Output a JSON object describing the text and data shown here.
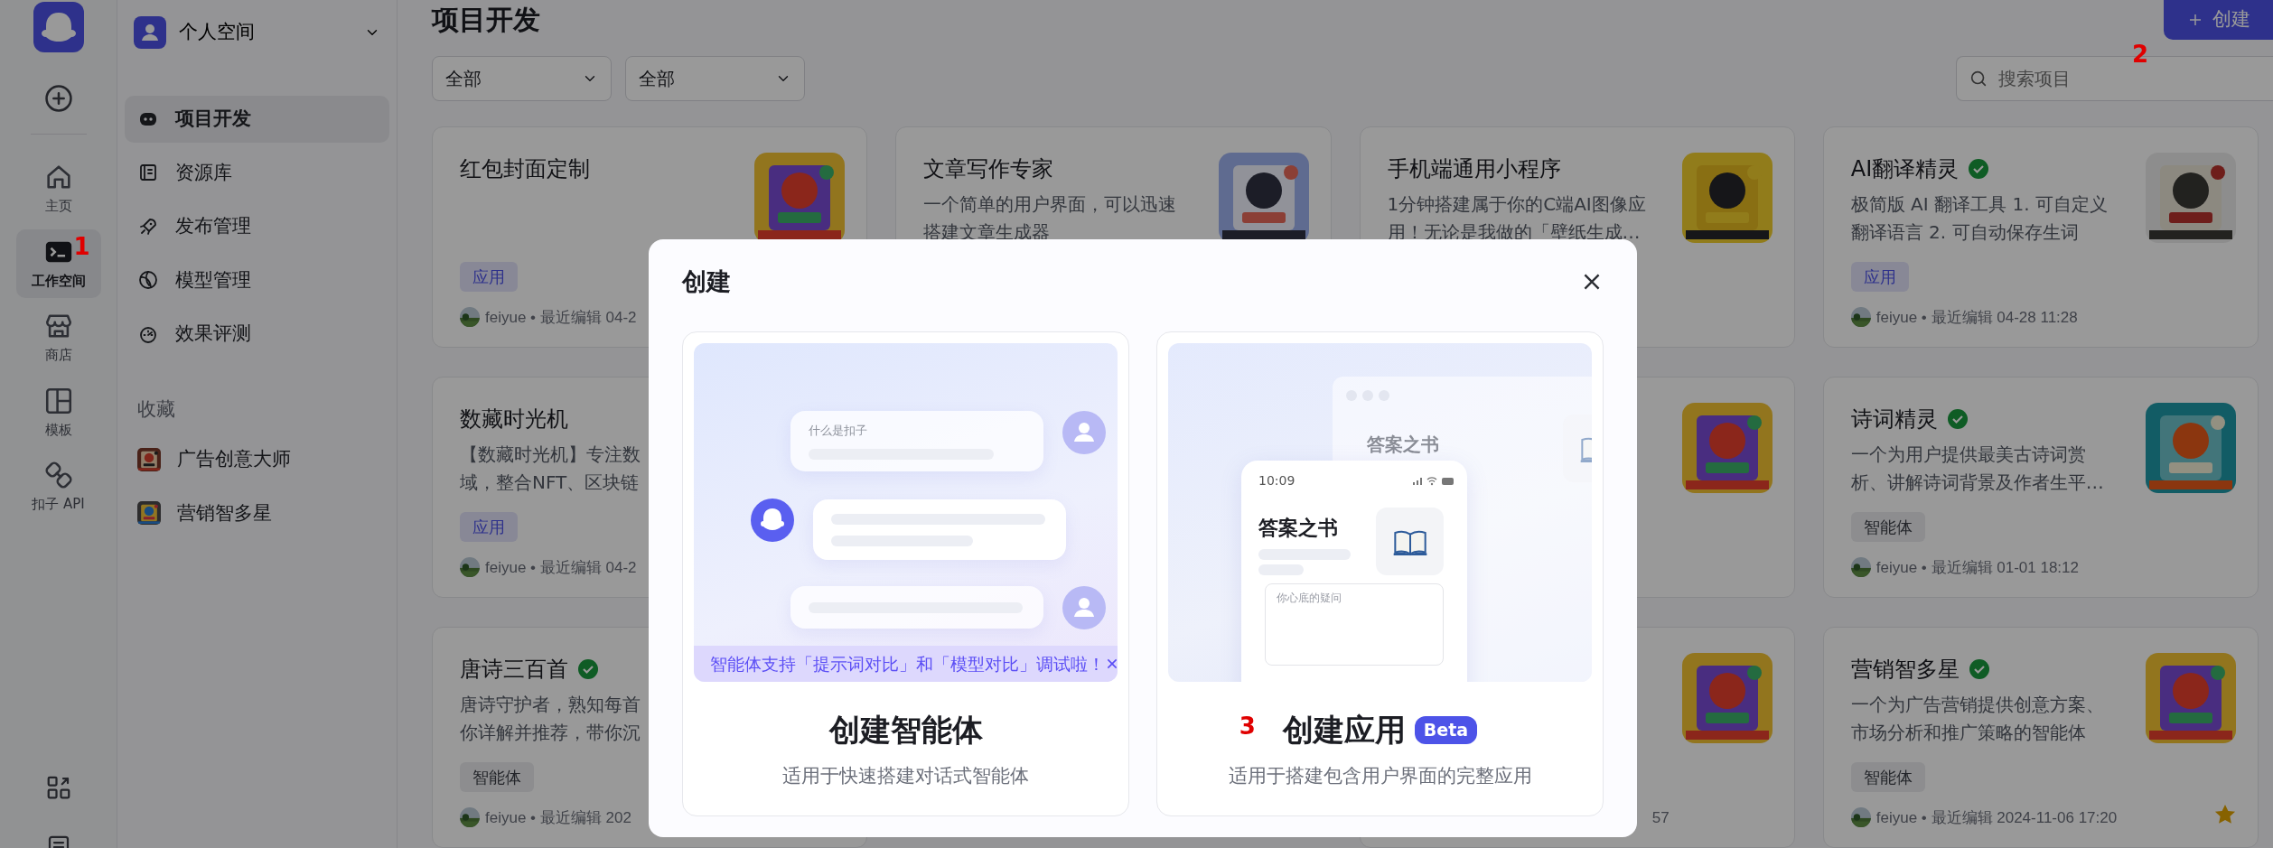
{
  "rail": {
    "items": [
      {
        "kind": "home",
        "label": "主页",
        "selected": false
      },
      {
        "kind": "terminal",
        "label": "工作空间",
        "selected": true,
        "annotation": "1"
      },
      {
        "kind": "store",
        "label": "商店",
        "selected": false
      },
      {
        "kind": "template",
        "label": "模板",
        "selected": false
      },
      {
        "kind": "plug",
        "label": "扣子 API",
        "selected": false
      }
    ]
  },
  "workspace": {
    "name": "个人空间"
  },
  "nav": {
    "items": [
      {
        "kind": "bot",
        "label": "项目开发",
        "selected": true
      },
      {
        "kind": "library",
        "label": "资源库",
        "selected": false
      },
      {
        "kind": "rocket",
        "label": "发布管理",
        "selected": false
      },
      {
        "kind": "model",
        "label": "模型管理",
        "selected": false
      },
      {
        "kind": "gauge",
        "label": "效果评测",
        "selected": false
      }
    ],
    "favorites_title": "收藏",
    "favorites": [
      {
        "label": "广告创意大师"
      },
      {
        "label": "营销智多星"
      }
    ]
  },
  "header": {
    "title": "项目开发",
    "create_button": "创建",
    "annotation": "2"
  },
  "filters": [
    {
      "value": "全部"
    },
    {
      "value": "全部"
    }
  ],
  "search": {
    "placeholder": "搜索项目"
  },
  "projects": [
    {
      "kind": "project",
      "title": "红包封面定制",
      "verified": false,
      "tag": {
        "label": "应用",
        "kind": "app"
      },
      "meta": {
        "avatar": true,
        "text": "feiyue • 最近编辑 04-2"
      }
    },
    {
      "kind": "project",
      "title": "文章写作专家",
      "verified": false,
      "description": [
        "一个简单的用户界面，可以迅速",
        "搭建文章生成器"
      ]
    },
    {
      "kind": "project",
      "title": "手机端通用小程序",
      "verified": false,
      "description": [
        "1分钟搭建属于你的C端AI图像应",
        "用！无论是我做的「壁纸生成…"
      ]
    },
    {
      "kind": "project",
      "title": "AI翻译精灵",
      "verified": true,
      "description": [
        "极简版 AI 翻译工具 1. 可自定义",
        "翻译语言 2. 可自动保存生词"
      ],
      "tag": {
        "label": "应用",
        "kind": "app"
      },
      "meta": {
        "avatar": true,
        "text": "feiyue • 最近编辑 04-28 11:28"
      },
      "starred": false
    },
    {
      "kind": "project",
      "title": "数藏时光机",
      "verified": false,
      "description": [
        "【数藏时光机】专注数",
        "域，整合NFT、区块链"
      ],
      "tag": {
        "label": "应用",
        "kind": "app"
      },
      "meta": {
        "avatar": true,
        "text": "feiyue • 最近编辑 04-2"
      }
    },
    {
      "kind": "project"
    },
    {
      "kind": "project",
      "title": "诗词精灵",
      "verified": true,
      "description": [
        "一个为用户提供最美古诗词赏",
        "析、讲解诗词背景及作者生平…"
      ],
      "tag": {
        "label": "智能体",
        "kind": "agent"
      },
      "meta": {
        "avatar": true,
        "text": "feiyue • 最近编辑 01-01 18:12"
      },
      "starred": false
    },
    {
      "kind": "project",
      "title": "唐诗三百首",
      "verified": true,
      "description": [
        "唐诗守护者，熟知每首",
        "你详解并推荐，带你沉"
      ],
      "tag": {
        "label": "智能体",
        "kind": "agent"
      },
      "meta": {
        "avatar": true,
        "text": "feiyue • 最近编辑 202"
      }
    },
    {
      "kind": "project",
      "meta": {
        "avatar": false,
        "text": "57"
      }
    },
    {
      "kind": "project",
      "title": "营销智多星",
      "verified": true,
      "description": [
        "一个为广告营销提供创意方案、",
        "市场分析和推广策略的智能体"
      ],
      "tag": {
        "label": "智能体",
        "kind": "agent"
      },
      "meta": {
        "avatar": true,
        "text": "feiyue • 最近编辑 2024-11-06 17:20"
      },
      "starred": true
    }
  ],
  "modal": {
    "title": "创建",
    "options": [
      {
        "kind": "agent",
        "illustration": {
          "question": "什么是扣子"
        },
        "banner": "智能体支持「提示词对比」和「模型对比」调试啦！",
        "heading": "创建智能体",
        "description": "适用于快速搭建对话式智能体"
      },
      {
        "kind": "app",
        "illustration": {
          "window_title": "答案之书",
          "time": "10:09",
          "app_title": "答案之书",
          "input_placeholder": "你心底的疑问"
        },
        "heading": "创建应用",
        "badge": "Beta",
        "annotation": "3",
        "description": "适用于搭建包含用户界面的完整应用"
      }
    ]
  }
}
